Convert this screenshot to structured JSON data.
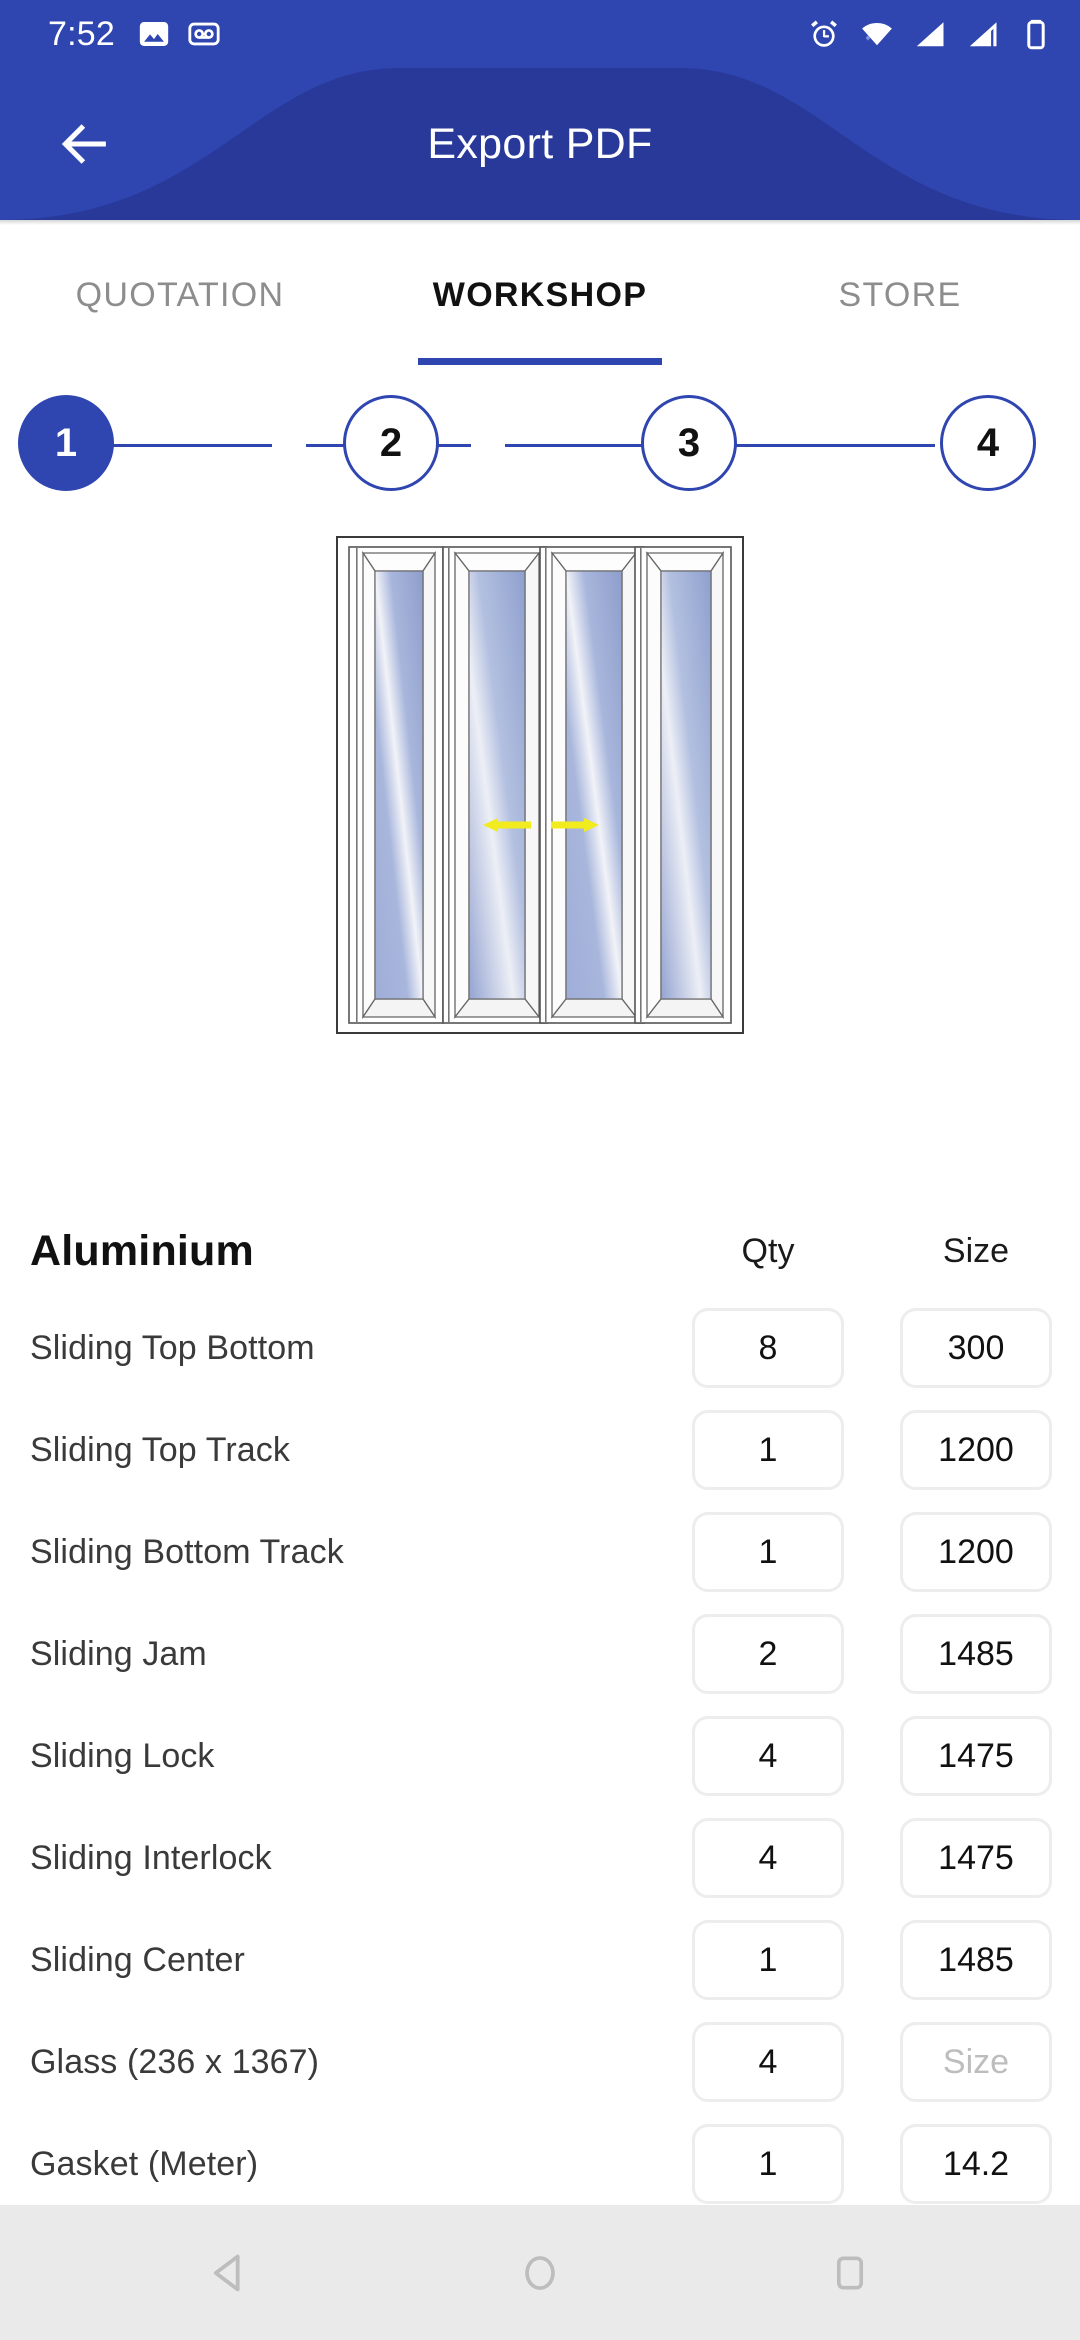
{
  "status_bar": {
    "time": "7:52",
    "left_icons": [
      "image-icon",
      "voicemail-icon"
    ],
    "right_icons": [
      "alarm-icon",
      "wifi-icon",
      "signal-icon",
      "signal-alt-icon",
      "battery-icon"
    ]
  },
  "app_bar": {
    "title": "Export PDF",
    "back_icon": "arrow-left-icon",
    "background_color": "#2F45B0"
  },
  "tabs": [
    {
      "label": "QUOTATION",
      "active": false
    },
    {
      "label": "WORKSHOP",
      "active": true
    },
    {
      "label": "STORE",
      "active": false
    }
  ],
  "stepper": {
    "steps": [
      {
        "label": "1",
        "state": "active"
      },
      {
        "label": "2",
        "state": "inactive"
      },
      {
        "label": "3",
        "state": "inactive"
      },
      {
        "label": "4",
        "state": "inactive"
      }
    ],
    "accent_color": "#2F45B0"
  },
  "diagram": {
    "name": "sliding-door-diagram",
    "panels": 4,
    "arrow_color": "#F2EB1E",
    "glass_color": "#9FAED8",
    "frame_color": "#ffffff"
  },
  "table": {
    "headers": {
      "name": "Aluminium",
      "qty": "Qty",
      "size": "Size"
    },
    "size_placeholder": "Size",
    "rows": [
      {
        "name": "Sliding Top Bottom",
        "qty": "8",
        "size": "300",
        "size_is_placeholder": false
      },
      {
        "name": "Sliding Top Track",
        "qty": "1",
        "size": "1200",
        "size_is_placeholder": false
      },
      {
        "name": "Sliding Bottom Track",
        "qty": "1",
        "size": "1200",
        "size_is_placeholder": false
      },
      {
        "name": "Sliding Jam",
        "qty": "2",
        "size": "1485",
        "size_is_placeholder": false
      },
      {
        "name": "Sliding Lock",
        "qty": "4",
        "size": "1475",
        "size_is_placeholder": false
      },
      {
        "name": "Sliding Interlock",
        "qty": "4",
        "size": "1475",
        "size_is_placeholder": false
      },
      {
        "name": "Sliding Center",
        "qty": "1",
        "size": "1485",
        "size_is_placeholder": false
      },
      {
        "name": "Glass (236 x 1367)",
        "qty": "4",
        "size": "Size",
        "size_is_placeholder": true
      },
      {
        "name": "Gasket (Meter)",
        "qty": "1",
        "size": "14.2",
        "size_is_placeholder": false
      }
    ]
  },
  "nav_bar": {
    "buttons": [
      "back-nav-icon",
      "home-nav-icon",
      "recents-nav-icon"
    ],
    "background_color": "#EAEAEA"
  }
}
